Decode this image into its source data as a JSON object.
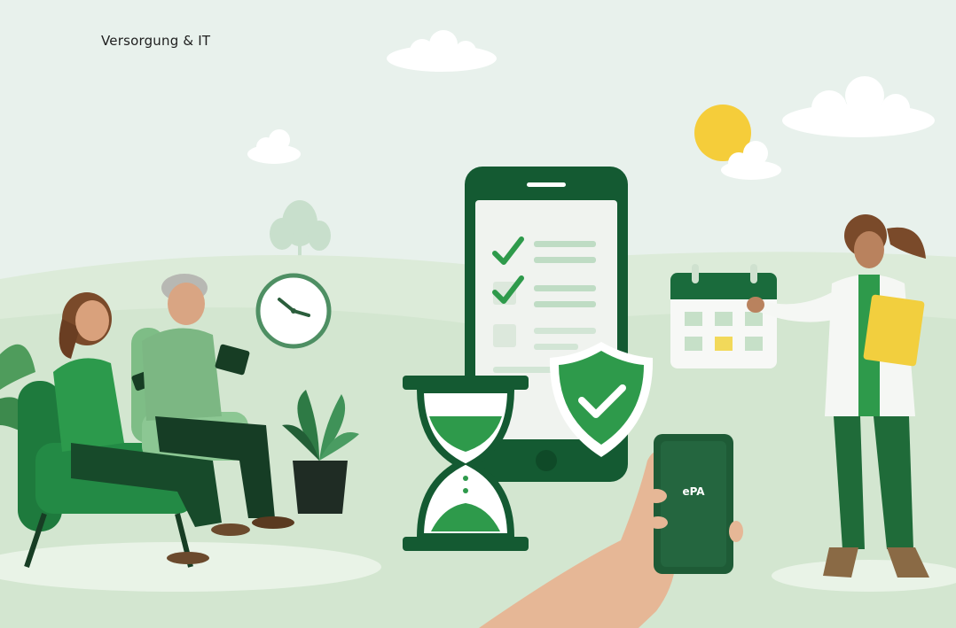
{
  "header": {
    "category": "Versorgung & IT"
  },
  "phone_screen": {
    "label": "ePA"
  },
  "colors": {
    "sky": "#e8f1ec",
    "hill_light": "#dcebd9",
    "hill_mid": "#cfe3cc",
    "brand_green": "#1a6b3c",
    "dark_green": "#135a32",
    "accent_green": "#2e9a4b",
    "sun": "#f5cd3a",
    "clipboard": "#f2cf3e"
  },
  "illustration": {
    "description_icons": [
      "cloud-icon",
      "sun-icon",
      "tree-icon",
      "clock-icon",
      "checklist-phone-icon",
      "shield-check-icon",
      "hourglass-icon",
      "calendar-icon",
      "plant-icon",
      "epa-phone-icon"
    ]
  }
}
